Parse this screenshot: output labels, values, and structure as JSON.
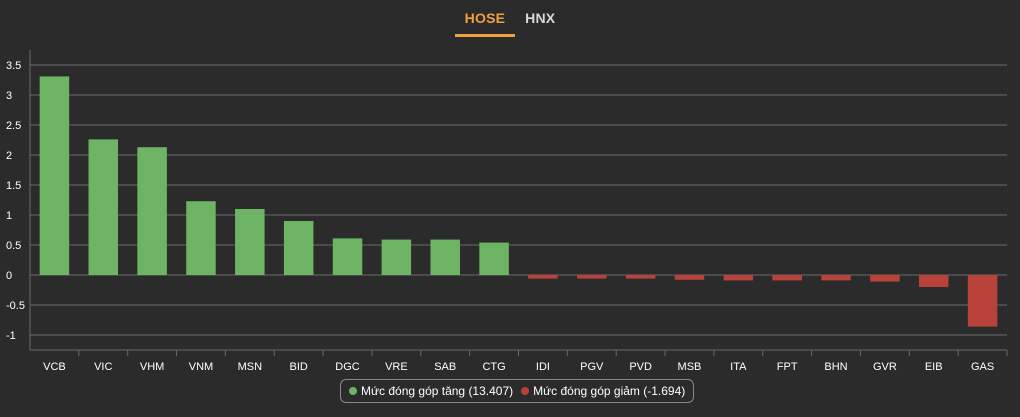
{
  "tabs": [
    {
      "label": "HOSE",
      "active": true
    },
    {
      "label": "HNX",
      "active": false
    }
  ],
  "legend": {
    "positive_label": "Mức đóng góp tăng (13.407)",
    "negative_label": "Mức đóng góp giảm (-1.694)"
  },
  "colors": {
    "positive": "#6db565",
    "negative": "#b8423a",
    "grid": "#6a6a6a",
    "axis_text": "#ffffff",
    "accent": "#f0a040",
    "background": "#2b2b2b"
  },
  "chart_data": {
    "type": "bar",
    "categories": [
      "VCB",
      "VIC",
      "VHM",
      "VNM",
      "MSN",
      "BID",
      "DGC",
      "VRE",
      "SAB",
      "CTG",
      "IDI",
      "PGV",
      "PVD",
      "MSB",
      "ITA",
      "FPT",
      "BHN",
      "GVR",
      "EIB",
      "GAS"
    ],
    "values": [
      3.31,
      2.26,
      2.13,
      1.23,
      1.1,
      0.9,
      0.61,
      0.59,
      0.59,
      0.54,
      -0.06,
      -0.06,
      -0.06,
      -0.08,
      -0.09,
      -0.09,
      -0.09,
      -0.11,
      -0.2,
      -0.86
    ],
    "ylim": [
      -1.2,
      3.7
    ],
    "yticks": [
      "3.5",
      "3",
      "2.5",
      "2",
      "1.5",
      "1",
      "0.5",
      "0",
      "-0.5",
      "-1"
    ],
    "ytick_values": [
      3.5,
      3,
      2.5,
      2,
      1.5,
      1,
      0.5,
      0,
      -0.5,
      -1
    ],
    "grid": true,
    "legend_position": "bottom-center"
  }
}
